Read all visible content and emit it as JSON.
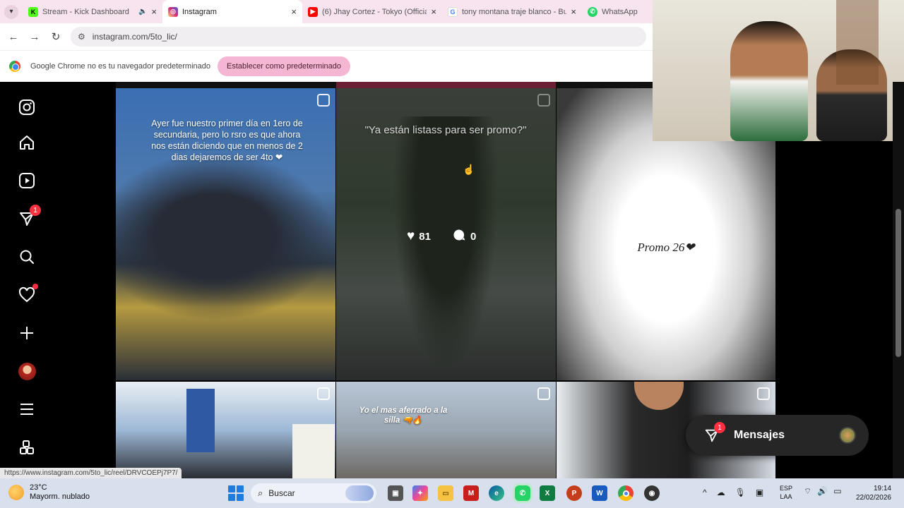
{
  "browser": {
    "tabs": [
      {
        "title": "Stream - Kick Dashboard",
        "favicon": "K",
        "color": "#53fc18",
        "audio": true
      },
      {
        "title": "Instagram",
        "favicon": "IG",
        "color": "#e1306c",
        "active": true
      },
      {
        "title": "(6) Jhay Cortez - Tokyo (Official",
        "favicon": "▶",
        "color": "#ff0000"
      },
      {
        "title": "tony montana traje blanco - Bu",
        "favicon": "G",
        "color": "#4285f4"
      },
      {
        "title": "WhatsApp",
        "favicon": "W",
        "color": "#25d366"
      }
    ],
    "url": "instagram.com/5to_lic/",
    "infobar": {
      "message": "Google Chrome no es tu navegador predeterminado",
      "button": "Establecer como predeterminado"
    },
    "status_url": "https://www.instagram.com/5to_lic/reel/DRVCOEPj7P7/"
  },
  "sidebar": {
    "icons": [
      {
        "name": "instagram-logo-icon",
        "glyph": "◎"
      },
      {
        "name": "home-icon",
        "glyph": "⌂"
      },
      {
        "name": "reels-icon",
        "glyph": "▶"
      },
      {
        "name": "messenger-icon",
        "glyph": "✈",
        "badge": "1"
      },
      {
        "name": "search-icon",
        "glyph": "⌕"
      },
      {
        "name": "notifications-heart-icon",
        "glyph": "♡",
        "dot": true
      },
      {
        "name": "create-plus-icon",
        "glyph": "+"
      },
      {
        "name": "profile-avatar",
        "glyph": ""
      },
      {
        "name": "more-menu-icon",
        "glyph": "≡"
      },
      {
        "name": "apps-icon",
        "glyph": "⊞"
      }
    ]
  },
  "posts": {
    "p1_caption": "Ayer fue nuestro primer día en 1ero de secundaria, pero lo rsro es que ahora nos están diciendo que en menos de 2 dias dejaremos de ser 4to ❤",
    "p2_caption": "\"Ya están listass para ser promo?\"",
    "p2_likes": "81",
    "p2_comments": "0",
    "p3_caption": "Promo 26❤",
    "p5_caption": "Yo el mas aferrado a la silla 🔫🔥"
  },
  "messages": {
    "label": "Mensajes",
    "badge": "1"
  },
  "taskbar": {
    "weather_temp": "23°C",
    "weather_desc": "Mayorm. nublado",
    "search": "Buscar",
    "lang1": "ESP",
    "lang2": "LAA",
    "time": "19:14",
    "date": "22/02/2026"
  }
}
